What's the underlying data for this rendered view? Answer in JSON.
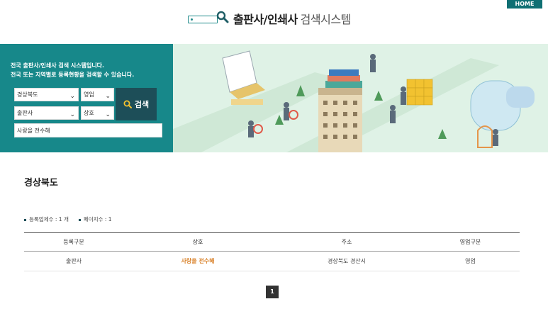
{
  "header": {
    "title": "출판사/인쇄사",
    "subtitle": "검색시스템",
    "home_label": "HOME"
  },
  "search": {
    "intro_line1": "전국 출판사/인쇄사 검색 시스템입니다.",
    "intro_line2": "전국 또는 지역별로 등록현황을 검색할 수 있습니다.",
    "region_value": "경상북도",
    "status_value": "영업",
    "type_value": "출판사",
    "field_value": "상호",
    "keyword_value": "사랑을 전수해",
    "button_label": "검색",
    "icon": "search-icon"
  },
  "result": {
    "region_title": "경상북도",
    "count_label": "등록업체수 : 1 개",
    "pages_label": "페이지수 : 1",
    "columns": [
      "등록구분",
      "상호",
      "주소",
      "영업구분"
    ],
    "rows": [
      {
        "type": "출판사",
        "name": "사랑을 전수해",
        "address": "경상북도 경산시",
        "status": "영업"
      }
    ]
  },
  "pagination": {
    "current": "1"
  },
  "colors": {
    "panel": "#17888a",
    "search_button": "#1d4e58",
    "home_button": "#0f6f73",
    "highlight": "#d9822b"
  }
}
